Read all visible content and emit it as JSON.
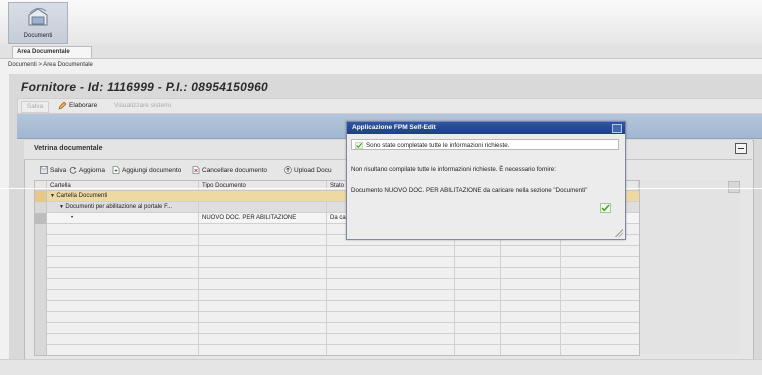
{
  "app": {
    "documents_tab_label": "Documenti",
    "nav_tab_label": "Area Documentale",
    "breadcrumb": "Documenti > Area Documentale"
  },
  "page": {
    "title": "Fornitore - Id: 1116999 - P.I.: 08954150960"
  },
  "toolbar": {
    "save_label": "Salva",
    "edit_label": "Elaborare",
    "view_label": "Visualizzare sistemi"
  },
  "panel": {
    "title": "Vetrina documentale",
    "actions": {
      "save": "Salva",
      "refresh": "Aggiorna",
      "add_doc": "Aggiungi documento",
      "delete_doc": "Cancellare documento",
      "upload": "Upload Docu"
    }
  },
  "grid": {
    "columns": [
      "Cartella",
      "Tipo Documento",
      "Stato"
    ],
    "rows": [
      {
        "col1": "Cartella Documenti",
        "col2": "",
        "col3": ""
      },
      {
        "col1": "Documenti per abilitazione al portale F...",
        "col2": "",
        "col3": ""
      },
      {
        "col1": "•",
        "col2": "NUOVO DOC. PER ABILITAZIONE",
        "col3": "Da ca"
      }
    ]
  },
  "dialog": {
    "title": "Applicazione FPM Self-Edit",
    "success_message": "Sono state completate tutte le informazioni richieste.",
    "info_text": "Non risultano compilate tutte le informazioni richieste. È necessario fornire:",
    "detail_text": "Documento NUOVO DOC. PER ABILITAZIONE da caricare nella sezione \"Documenti\""
  },
  "colors": {
    "dialog_title_bg": "#2a4f9c",
    "group_row_bg": "#efd9a3",
    "blue_bar_bg": "#aabdd5",
    "check_green": "#3f9a2c"
  }
}
